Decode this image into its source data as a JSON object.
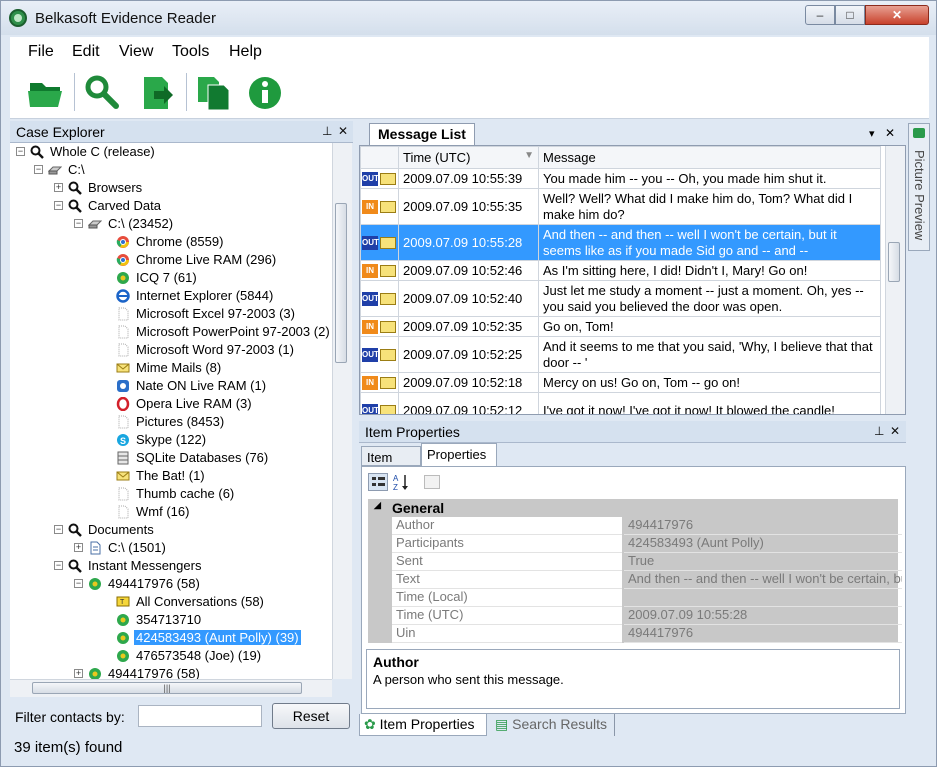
{
  "window": {
    "title": "Belkasoft Evidence Reader",
    "min": "–",
    "max": "□",
    "close": "✕"
  },
  "menu": [
    "File",
    "Edit",
    "View",
    "Tools",
    "Help"
  ],
  "case_explorer": {
    "title": "Case Explorer",
    "pin": "⊥",
    "close": "✕",
    "tree": [
      {
        "label": "Whole C (release)",
        "indent": 0,
        "exp": "−",
        "icon": "search-icon"
      },
      {
        "label": "C:\\",
        "indent": 1,
        "exp": "−",
        "icon": "drive-icon"
      },
      {
        "label": "Browsers",
        "indent": 2,
        "exp": "+",
        "icon": "search-icon"
      },
      {
        "label": "Carved Data",
        "indent": 2,
        "exp": "−",
        "icon": "search-icon"
      },
      {
        "label": "C:\\ (23452)",
        "indent": 3,
        "exp": "−",
        "icon": "drive-icon"
      },
      {
        "label": "Chrome (8559)",
        "indent": 4,
        "icon": "chrome-icon"
      },
      {
        "label": "Chrome Live RAM (296)",
        "indent": 4,
        "icon": "chrome-icon"
      },
      {
        "label": "ICQ 7 (61)",
        "indent": 4,
        "icon": "icq-icon"
      },
      {
        "label": "Internet Explorer (5844)",
        "indent": 4,
        "icon": "ie-icon"
      },
      {
        "label": "Microsoft Excel 97-2003 (3)",
        "indent": 4,
        "icon": "doc-icon"
      },
      {
        "label": "Microsoft PowerPoint 97-2003 (2)",
        "indent": 4,
        "icon": "doc-icon"
      },
      {
        "label": "Microsoft Word 97-2003 (1)",
        "indent": 4,
        "icon": "doc-icon"
      },
      {
        "label": "Mime Mails (8)",
        "indent": 4,
        "icon": "mail-icon"
      },
      {
        "label": "Nate ON Live RAM (1)",
        "indent": 4,
        "icon": "nateon-icon"
      },
      {
        "label": "Opera Live RAM (3)",
        "indent": 4,
        "icon": "opera-icon"
      },
      {
        "label": "Pictures (8453)",
        "indent": 4,
        "icon": "doc-icon"
      },
      {
        "label": "Skype (122)",
        "indent": 4,
        "icon": "skype-icon"
      },
      {
        "label": "SQLite Databases (76)",
        "indent": 4,
        "icon": "database-icon"
      },
      {
        "label": "The Bat! (1)",
        "indent": 4,
        "icon": "mail-icon"
      },
      {
        "label": "Thumb cache (6)",
        "indent": 4,
        "icon": "doc-icon"
      },
      {
        "label": "Wmf (16)",
        "indent": 4,
        "icon": "doc-icon"
      },
      {
        "label": "Documents",
        "indent": 2,
        "exp": "−",
        "icon": "search-icon"
      },
      {
        "label": "C:\\ (1501)",
        "indent": 3,
        "exp": "+",
        "icon": "document-icon"
      },
      {
        "label": "Instant Messengers",
        "indent": 2,
        "exp": "−",
        "icon": "search-icon"
      },
      {
        "label": "494417976 (58)",
        "indent": 3,
        "exp": "−",
        "icon": "icq-icon"
      },
      {
        "label": "All Conversations (58)",
        "indent": 4,
        "icon": "conversation-icon"
      },
      {
        "label": "354713710",
        "indent": 4,
        "icon": "icq-icon"
      },
      {
        "label": "424583493 (Aunt Polly) (39)",
        "indent": 4,
        "icon": "icq-icon",
        "selected": true
      },
      {
        "label": "476573548 (Joe) (19)",
        "indent": 4,
        "icon": "icq-icon"
      },
      {
        "label": "494417976 (58)",
        "indent": 3,
        "exp": "+",
        "icon": "icq-icon"
      }
    ],
    "hscroll_thumb": "|||"
  },
  "filter": {
    "label": "Filter contacts by:",
    "value": "",
    "reset": "Reset"
  },
  "status": "39 item(s) found",
  "message_list": {
    "title": "Message List",
    "menu": "▾",
    "close": "✕",
    "columns": [
      "Time (UTC)",
      "Message"
    ],
    "rows": [
      {
        "dir": "OUT",
        "time": "2009.07.09 10:55:39",
        "msg": "You made him -- you -- Oh, you made him shut it."
      },
      {
        "dir": "IN",
        "time": "2009.07.09 10:55:35",
        "msg": "Well? Well? What did I make him do, Tom? What did I make him do?"
      },
      {
        "dir": "OUT",
        "time": "2009.07.09 10:55:28",
        "msg": "And then -- and then -- well I won't be certain, but it seems like as if you made Sid go and -- and --",
        "selected": true
      },
      {
        "dir": "IN",
        "time": "2009.07.09 10:52:46",
        "msg": "As I'm sitting here, I did! Didn't I, Mary! Go on!"
      },
      {
        "dir": "OUT",
        "time": "2009.07.09 10:52:40",
        "msg": "Just let me study a moment -- just a moment. Oh, yes -- you said you believed the door was open."
      },
      {
        "dir": "IN",
        "time": "2009.07.09 10:52:35",
        "msg": "Go on, Tom!"
      },
      {
        "dir": "OUT",
        "time": "2009.07.09 10:52:25",
        "msg": "And it seems to me that you said, 'Why, I believe that that door -- '"
      },
      {
        "dir": "IN",
        "time": "2009.07.09 10:52:18",
        "msg": "Mercy on us! Go on, Tom -- go on!"
      },
      {
        "dir": "OUT",
        "time": "2009.07.09 10:52:12",
        "msg": "I've got it now! I've got it now! It blowed the candle!"
      }
    ]
  },
  "item_properties": {
    "title": "Item Properties",
    "pin": "⊥",
    "close": "✕",
    "tabs": [
      "Item text",
      "Properties"
    ],
    "group": "General",
    "props": [
      {
        "k": "Author",
        "v": "494417976"
      },
      {
        "k": "Participants",
        "v": "424583493 (Aunt Polly)"
      },
      {
        "k": "Sent",
        "v": "True"
      },
      {
        "k": "Text",
        "v": "And then -- and then -- well I won't be certain, but it"
      },
      {
        "k": "Time (Local)",
        "v": ""
      },
      {
        "k": "Time (UTC)",
        "v": "2009.07.09 10:55:28"
      },
      {
        "k": "Uin",
        "v": "494417976"
      }
    ],
    "desc_title": "Author",
    "desc_text": "A person who sent this message."
  },
  "bottom_tabs": [
    "Item Properties",
    "Search Results"
  ],
  "picture_preview": "Picture Preview",
  "colors": {
    "selection": "#3399ff",
    "panel": "#dfe8f3"
  }
}
